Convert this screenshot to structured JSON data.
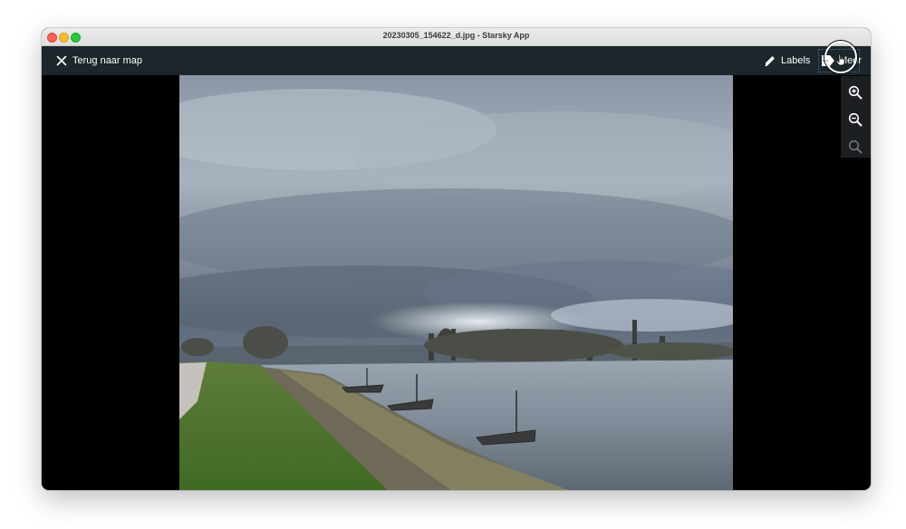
{
  "window": {
    "title": "20230305_154622_d.jpg - Starsky App"
  },
  "toolbar": {
    "back_label": "Terug naar map",
    "labels_label": "Labels",
    "more_label": "Meer"
  },
  "zoom": {
    "zoom_in_icon": "zoom-in-icon",
    "zoom_out_icon": "zoom-out-icon",
    "zoom_reset_icon": "zoom-reset-icon"
  },
  "photo": {
    "description_icon": "landscape-photo"
  },
  "colors": {
    "toolbar_bg": "#1c262b",
    "viewer_bg": "#000000",
    "zoom_panel_bg": "#1c1f22"
  }
}
